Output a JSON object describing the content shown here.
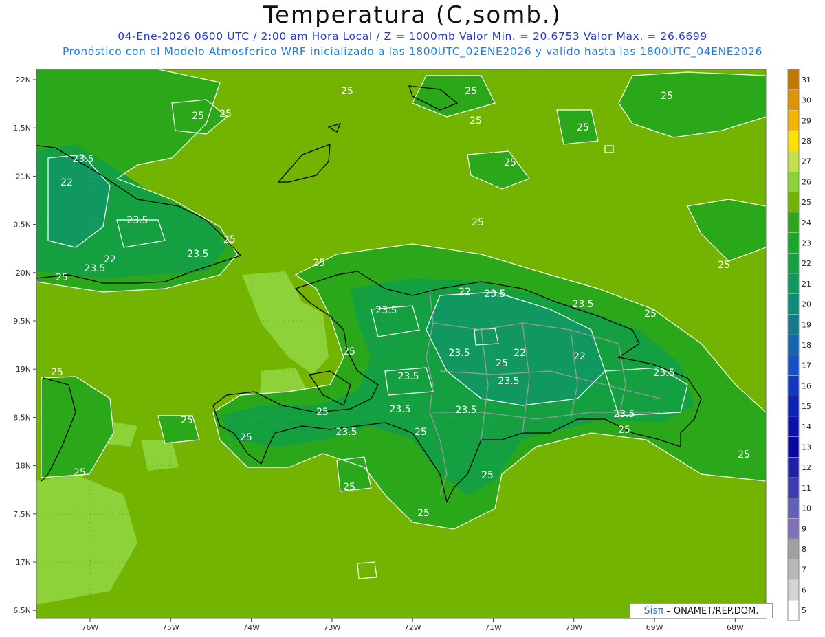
{
  "header": {
    "title": "Temperatura (C,somb.)",
    "line1": "04-Ene-2026  0600 UTC / 2:00 am Hora Local / Z = 1000mb   Valor Min. = 20.6753  Valor Max. = 26.6699",
    "line2": "Pronóstico con el Modelo Atmosferico WRF inicializado a las 1800UTC_02ENE2026 y valido hasta las  1800UTC_04ENE2026"
  },
  "axes": {
    "lat_labels": [
      "22N",
      "1.5N",
      "21N",
      "0.5N",
      "20N",
      "9.5N",
      "19N",
      "8.5N",
      "18N",
      "7.5N",
      "17N",
      "6.5N"
    ],
    "lon_labels": [
      "76W",
      "75W",
      "74W",
      "73W",
      "72W",
      "71W",
      "70W",
      "69W",
      "68W"
    ]
  },
  "colorbar": {
    "labels": [
      "31",
      "30",
      "29",
      "28",
      "27",
      "26",
      "25",
      "24",
      "23",
      "22",
      "21",
      "20",
      "19",
      "18",
      "17",
      "16",
      "15",
      "14",
      "13",
      "12",
      "11",
      "10",
      "9",
      "8",
      "7",
      "6",
      "5"
    ],
    "colors": [
      "#c07800",
      "#e09400",
      "#f2b400",
      "#ffe000",
      "#c6e04a",
      "#8ed23a",
      "#72b400",
      "#2aa81a",
      "#18a828",
      "#14a040",
      "#119860",
      "#108a78",
      "#127a8a",
      "#1466b2",
      "#1450c8",
      "#1038c4",
      "#0a24b8",
      "#0a12aa",
      "#0808a0",
      "#2020a6",
      "#3c3cb0",
      "#6060b8",
      "#8070b8",
      "#a0a0a0",
      "#b8b8b8",
      "#d4d4d4",
      "#ffffff"
    ]
  },
  "contour_labels": [
    {
      "text": "25"
    },
    {
      "text": "25"
    },
    {
      "text": "25"
    },
    {
      "text": "25"
    },
    {
      "text": "25"
    },
    {
      "text": "25"
    },
    {
      "text": "25"
    },
    {
      "text": "23.5"
    },
    {
      "text": "22"
    },
    {
      "text": "23.5"
    },
    {
      "text": "23.5"
    },
    {
      "text": "22"
    },
    {
      "text": "23.5"
    },
    {
      "text": "25"
    },
    {
      "text": "25"
    },
    {
      "text": "25"
    },
    {
      "text": "25"
    },
    {
      "text": "22"
    },
    {
      "text": "23.5"
    },
    {
      "text": "23.5"
    },
    {
      "text": "25"
    },
    {
      "text": "23.5"
    },
    {
      "text": "22"
    },
    {
      "text": "22"
    },
    {
      "text": "25"
    },
    {
      "text": "23.5"
    },
    {
      "text": "23.5"
    },
    {
      "text": "25"
    },
    {
      "text": "23.5"
    },
    {
      "text": "23.5"
    },
    {
      "text": "25"
    },
    {
      "text": "23.5"
    },
    {
      "text": "23.5"
    },
    {
      "text": "23.5"
    },
    {
      "text": "25"
    },
    {
      "text": "25"
    },
    {
      "text": "25"
    },
    {
      "text": "25"
    },
    {
      "text": "25"
    },
    {
      "text": "25"
    },
    {
      "text": "25"
    },
    {
      "text": "25"
    },
    {
      "text": "25"
    },
    {
      "text": "25"
    },
    {
      "text": "23.5"
    },
    {
      "text": "25"
    },
    {
      "text": "25"
    }
  ],
  "credit": {
    "brand": "Sisπ",
    "text": " – ONAMET/REP.DOM."
  }
}
